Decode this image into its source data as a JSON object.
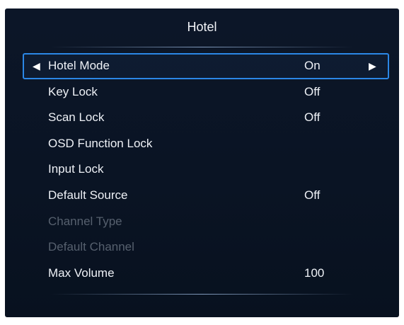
{
  "title": "Hotel",
  "items": [
    {
      "label": "Hotel Mode",
      "value": "On"
    },
    {
      "label": "Key Lock",
      "value": "Off"
    },
    {
      "label": "Scan Lock",
      "value": "Off"
    },
    {
      "label": "OSD Function Lock",
      "value": ""
    },
    {
      "label": "Input Lock",
      "value": ""
    },
    {
      "label": "Default Source",
      "value": "Off"
    },
    {
      "label": "Channel Type",
      "value": ""
    },
    {
      "label": "Default Channel",
      "value": ""
    },
    {
      "label": "Max Volume",
      "value": "100"
    }
  ],
  "icons": {
    "left": "arrow-left-icon",
    "right": "arrow-right-icon"
  },
  "colors": {
    "selection_border": "#2b87e6",
    "disabled_text": "#56606e",
    "background": "#0a1424"
  }
}
